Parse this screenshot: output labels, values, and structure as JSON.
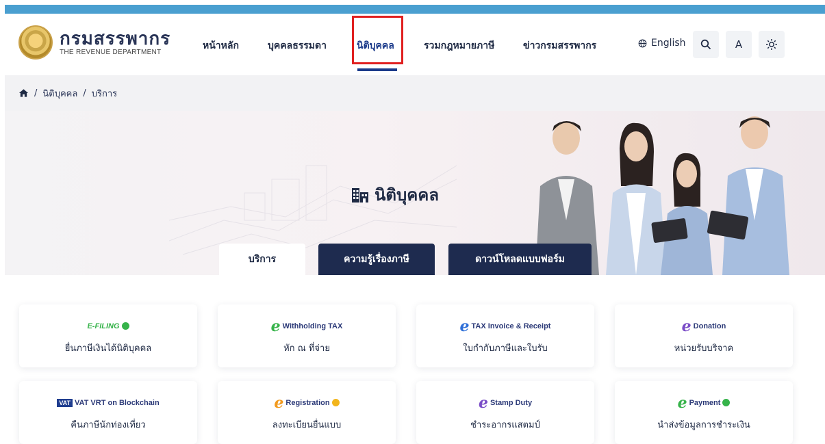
{
  "header": {
    "logo_th": "กรมสรรพากร",
    "logo_en": "THE REVENUE DEPARTMENT",
    "nav": [
      {
        "label": "หน้าหลัก"
      },
      {
        "label": "บุคคลธรรมดา"
      },
      {
        "label": "นิติบุคคล"
      },
      {
        "label": "รวมกฎหมายภาษี"
      },
      {
        "label": "ข่าวกรมสรรพากร"
      }
    ],
    "active_nav": "นิติบุคคล",
    "language": "English",
    "font_size_label": "A",
    "colors": {
      "stripe": "#4a9fd0",
      "active": "#1b3a8a",
      "highlight": "#e02020"
    }
  },
  "breadcrumb": {
    "items": [
      "นิติบุคคล",
      "บริการ"
    ],
    "separator": "/"
  },
  "hero": {
    "title": "นิติบุคคล",
    "tabs": [
      {
        "label": "บริการ",
        "active": true
      },
      {
        "label": "ความรู้เรื่องภาษี",
        "active": false
      },
      {
        "label": "ดาวน์โหลดแบบฟอร์ม",
        "active": false
      }
    ]
  },
  "services": [
    {
      "logo": "E-FILING",
      "label": "ยื่นภาษีเงินได้นิติบุคคล"
    },
    {
      "logo": "Withholding TAX",
      "label": "หัก ณ ที่จ่าย"
    },
    {
      "logo": "TAX Invoice & Receipt",
      "label": "ใบกำกับภาษีและใบรับ"
    },
    {
      "logo": "Donation",
      "label": "หน่วยรับบริจาค"
    },
    {
      "logo": "VAT VRT on Blockchain",
      "label": "คืนภาษีนักท่องเที่ยว"
    },
    {
      "logo": "Registration",
      "label": "ลงทะเบียนยื่นแบบ"
    },
    {
      "logo": "Stamp Duty",
      "label": "ชำระอากรแสตมป์"
    },
    {
      "logo": "Payment",
      "label": "นำส่งข้อมูลการชำระเงิน"
    }
  ]
}
